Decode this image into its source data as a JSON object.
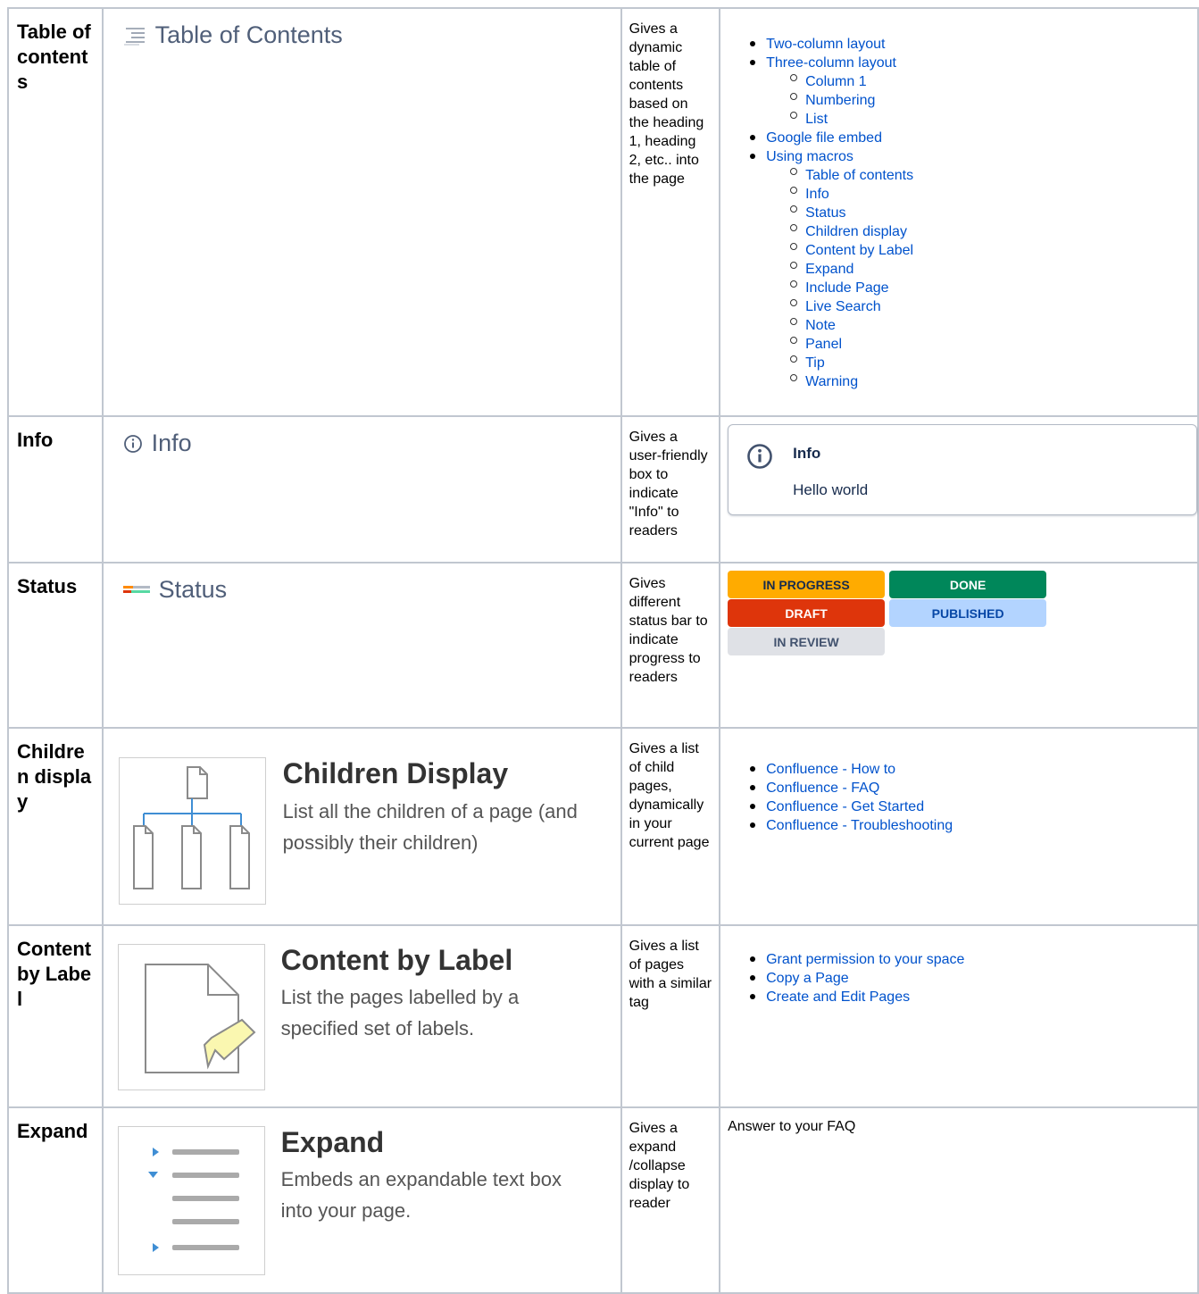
{
  "rows": {
    "toc": {
      "name": "Table of contents",
      "label": "Table of Contents",
      "description": "Gives a dynamic table of contents based on the heading 1, heading 2, etc.. into the page",
      "items": [
        {
          "label": "Two-column layout"
        },
        {
          "label": "Three-column layout",
          "children": [
            "Column 1",
            "Numbering",
            "List"
          ]
        },
        {
          "label": "Google file embed"
        },
        {
          "label": "Using macros",
          "children": [
            "Table of contents",
            "Info",
            "Status",
            "Children display",
            "Content by Label",
            "Expand",
            "Include Page",
            "Live Search",
            "Note",
            "Panel",
            "Tip",
            "Warning"
          ]
        }
      ]
    },
    "info": {
      "name": "Info",
      "label": "Info",
      "description": "Gives a user-friendly box to indicate \"Info\" to readers",
      "box_title": "Info",
      "box_body": "Hello world"
    },
    "status": {
      "name": "Status",
      "label": "Status",
      "description": "Gives different status bar to indicate progress to readers",
      "lozenges": [
        {
          "text": "IN PROGRESS",
          "bg": "#ffab00",
          "fg": "#172b4d"
        },
        {
          "text": "DONE",
          "bg": "#00875a",
          "fg": "#ffffff"
        },
        {
          "text": "DRAFT",
          "bg": "#de350b",
          "fg": "#ffffff"
        },
        {
          "text": "PUBLISHED",
          "bg": "#b3d4ff",
          "fg": "#0747a6"
        },
        {
          "text": "IN REVIEW",
          "bg": "#dfe1e6",
          "fg": "#42526e"
        }
      ]
    },
    "children": {
      "name": "Children display",
      "card_title": "Children Display",
      "card_desc_1": "List all the children of a page (and",
      "card_desc_2": "possibly their children)",
      "description": "Gives a list of child pages, dynamically in your current page",
      "links": [
        "Confluence - How to",
        "Confluence - FAQ",
        "Confluence - Get Started",
        "Confluence - Troubleshooting"
      ]
    },
    "label": {
      "name": "Content by Label",
      "card_title": "Content by Label",
      "card_desc_1": "List the pages labelled by a",
      "card_desc_2": "specified set of labels.",
      "description": "Gives a list of pages with a similar tag",
      "links": [
        "Grant permission to your space",
        "Copy a Page",
        "Create and Edit Pages"
      ]
    },
    "expand": {
      "name": "Expand",
      "card_title": "Expand",
      "card_desc_1": "Embeds an expandable text box",
      "card_desc_2": "into your page.",
      "description": "Gives a expand /collapse display to reader",
      "example": "Answer to your FAQ"
    }
  }
}
